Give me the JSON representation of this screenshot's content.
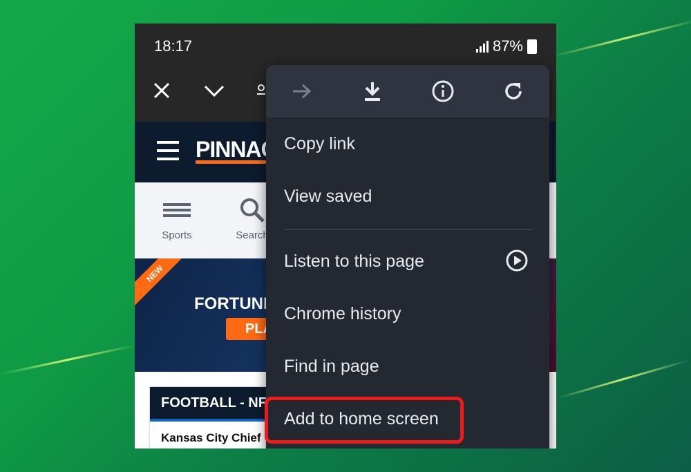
{
  "status_bar": {
    "time": "18:17",
    "battery": "87%"
  },
  "site": {
    "logo": "PINNAC",
    "nav": [
      {
        "label": "Sports"
      },
      {
        "label": "Search"
      }
    ],
    "banner": {
      "ribbon": "NEW",
      "title": "FORTUNI",
      "button": "PLA"
    },
    "card": {
      "header": "FOOTBALL - NF",
      "row": "Kansas City Chief"
    }
  },
  "menu": {
    "items": [
      {
        "label": "Copy link"
      },
      {
        "label": "View saved"
      },
      {
        "label": "Listen to this page"
      },
      {
        "label": "Chrome history"
      },
      {
        "label": "Find in page"
      },
      {
        "label": "Add to home screen"
      }
    ]
  },
  "colors": {
    "highlight": "#ee1b1b",
    "brand_accent": "#ff6a13",
    "menu_bg": "#242830"
  },
  "icons": [
    "close-icon",
    "chevron-down-icon",
    "forward-icon",
    "download-icon",
    "info-icon",
    "refresh-icon",
    "play-icon",
    "search-icon",
    "list-icon"
  ]
}
